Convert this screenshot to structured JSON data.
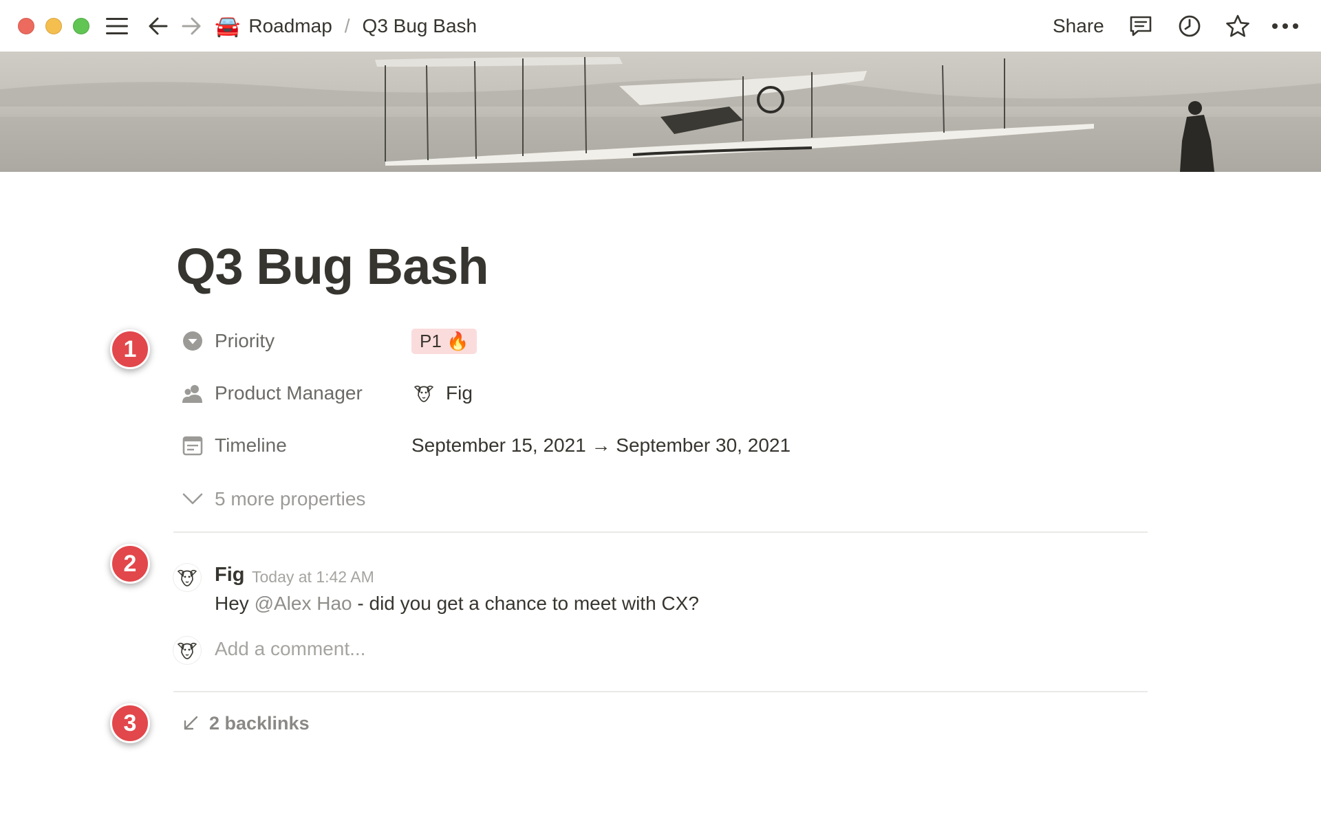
{
  "window": {
    "traffic_lights": [
      "close",
      "minimize",
      "zoom"
    ]
  },
  "topbar": {
    "menu_icon": "hamburger-menu-icon",
    "back_icon": "arrow-left-icon",
    "forward_icon": "arrow-right-icon",
    "breadcrumb": {
      "parent_emoji": "🚘",
      "parent": "Roadmap",
      "separator": "/",
      "current": "Q3 Bug Bash"
    },
    "share_label": "Share",
    "icons": [
      "comment-icon",
      "history-clock-icon",
      "favorite-star-icon",
      "more-options-icon"
    ]
  },
  "cover": {
    "description_icon": "cover-image-biplane"
  },
  "page": {
    "title": "Q3 Bug Bash"
  },
  "properties": [
    {
      "icon": "select-caret-icon",
      "label": "Priority",
      "value": "P1 🔥",
      "tag_color": "#fbdcdc"
    },
    {
      "icon": "person-icon",
      "label": "Product Manager",
      "value": "Fig"
    },
    {
      "icon": "calendar-icon",
      "label": "Timeline",
      "value": "September 15, 2021 → September 30, 2021"
    }
  ],
  "more_properties": "5 more properties",
  "comment": {
    "author": "Fig",
    "time": "Today at 1:42 AM",
    "text_before": "Hey ",
    "mention": "@Alex Hao",
    "text_after": " - did you get a chance to meet with CX?"
  },
  "add_comment_placeholder": "Add a comment...",
  "backlinks": "2 backlinks",
  "callouts": [
    "1",
    "2",
    "3"
  ],
  "colors": {
    "callout": "#e2474b",
    "priority_tag": "#fbdcdc",
    "text": "#37352f",
    "muted": "#9b9a97"
  }
}
